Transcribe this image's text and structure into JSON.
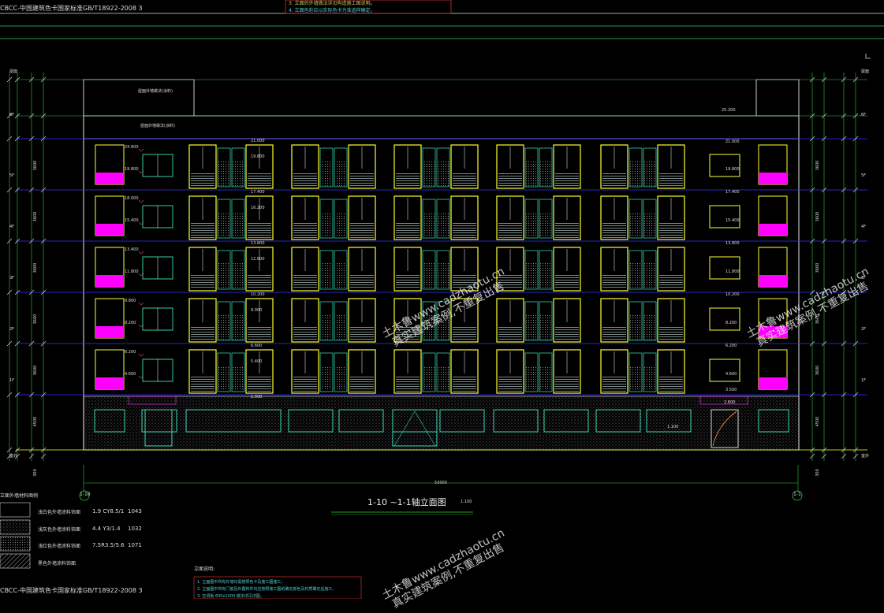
{
  "header": {
    "standard_top": "CBCC-中国建筑色卡国家标准GB/T18922-2008 3",
    "note_line_1": "3. 立面的外墙做法详见构造施工图说明。",
    "note_line_2": "4. 立面色彩应以实际色卡为准选样确定。"
  },
  "drawing": {
    "title": "1-10 ~1-1轴立面图",
    "scale": "1:100",
    "axis_left": "1-10",
    "axis_right": "1-1",
    "total_dim": "53000"
  },
  "callouts": {
    "roof_finish": "屋面外墙做法(涂料)",
    "parapet_finish": "屋面外墙做法(涂料)"
  },
  "elevations_left": [
    "24.600",
    "19.800",
    "18.000",
    "15.400",
    "13.400",
    "11.800",
    "9.800",
    "8.200",
    "6.200",
    "4.600"
  ],
  "elevations_right": [
    "25.200",
    "21.000",
    "19.800",
    "17.400",
    "15.400",
    "13.800",
    "11.800",
    "10.200",
    "8.200",
    "6.200",
    "4.600",
    "3.500",
    "2.600",
    "1.100"
  ],
  "elevations_mid": [
    "21.000",
    "19.800",
    "17.400",
    "16.200",
    "13.800",
    "12.600",
    "10.200",
    "9.000",
    "6.600",
    "5.400",
    "1.000"
  ],
  "floor_labels_left": [
    "屋面",
    "6F",
    "5F",
    "4F",
    "3F",
    "2F",
    "1F",
    "室外"
  ],
  "floor_labels_right": [
    "屋面",
    "6F",
    "5F",
    "4F",
    "3F",
    "2F",
    "1F",
    "室外"
  ],
  "dims_left": [
    "3600",
    "3600",
    "3600",
    "3600",
    "3600",
    "4500",
    "300"
  ],
  "legend": {
    "title": "立面外墙材料图例",
    "rows": [
      {
        "name": "浅白色外墙涂料饰面",
        "code": "1.9 CY8.5/1",
        "num": "1043"
      },
      {
        "name": "浅灰色外墙涂料饰面",
        "code": "4.4 Y3/1.4",
        "num": "1032"
      },
      {
        "name": "浅红色外墙涂料饰面",
        "code": "7.5R3.5/5.6",
        "num": "1071"
      },
      {
        "name": "黑色外墙涂料饰面",
        "code": "",
        "num": ""
      }
    ],
    "standard_bottom": "CBCC-中国建筑色卡国家标准GB/T18922-2008 3"
  },
  "notes": {
    "title": "立面说明:",
    "lines": [
      "1. 立面图中所有外墙均需按照色卡及施工图施工。",
      "2. 立面图中所有门窗及外露构件均应按照施工图纸确定颜色及材质确定后施工。",
      "3. 空调板 600x1000 做法详见详图。"
    ]
  },
  "watermarks": [
    {
      "line1": "土木鲁www.cadzhaotu.cn",
      "line2": "真实建筑案例,不重复出售"
    },
    {
      "line1": "土木鲁www.cadzhaotu.cn",
      "line2": "真实建筑案例,不重复出售"
    },
    {
      "line1": "土木鲁www.cadzhaotu.cn",
      "line2": "真实建筑案例,不重复出售"
    }
  ],
  "colors": {
    "background": "#000000",
    "outline": "#ffffff",
    "window_yellow": "#ffff33",
    "window_teal": "#33ccaa",
    "floor_line_blue": "#3333ff",
    "dim_green": "#33cc33",
    "balcony_magenta": "#ff00ff",
    "dim_cyan": "#00cccc"
  }
}
